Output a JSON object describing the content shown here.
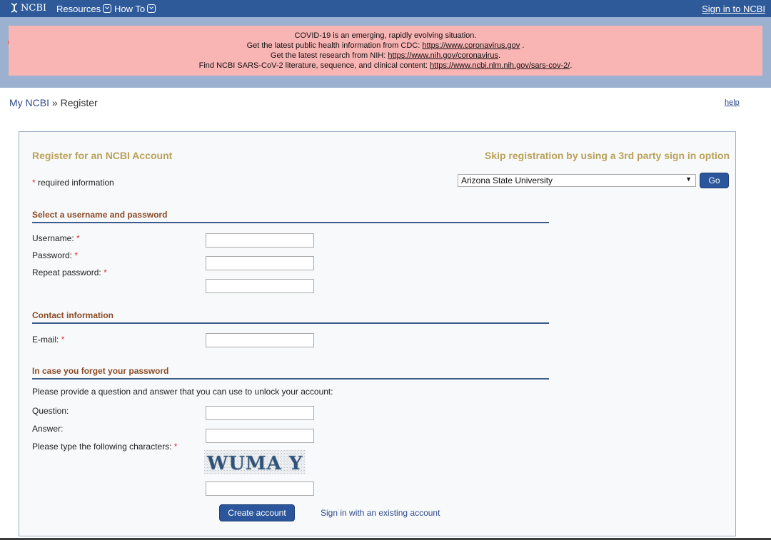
{
  "topbar": {
    "logo_text": "NCBI",
    "menu_resources": "Resources",
    "menu_howto": "How To",
    "signin": "Sign in to NCBI"
  },
  "banner": {
    "line1": "COVID-19 is an emerging, rapidly evolving situation.",
    "line2_prefix": "Get the latest public health information from CDC: ",
    "line2_link": "https://www.coronavirus.gov",
    "line2_suffix": " .",
    "line3_prefix": "Get the latest research from NIH: ",
    "line3_link": "https://www.nih.gov/coronavirus",
    "line3_suffix": ".",
    "line4_prefix": "Find NCBI SARS-CoV-2 literature, sequence, and clinical content: ",
    "line4_link": "https://www.ncbi.nlm.nih.gov/sars-cov-2/",
    "line4_suffix": "."
  },
  "breadcrumb": {
    "root": "My NCBI",
    "sep": " » ",
    "current": "Register"
  },
  "help": "help",
  "form": {
    "title": "Register for an NCBI Account",
    "skip_title": "Skip registration by using a 3rd party sign in option",
    "required_note": " required information",
    "asterisk": "*",
    "provider_selected": "Arizona State University",
    "go_label": "Go",
    "section_credentials": "Select a username and password",
    "username_label": "Username:",
    "password_label": "Password:",
    "repeat_password_label": "Repeat password:",
    "section_contact": "Contact information",
    "email_label": "E-mail:",
    "section_recovery": "In case you forget your password",
    "recovery_instructions": "Please provide a question and answer that you can use to unlock your account:",
    "question_label": "Question:",
    "answer_label": "Answer:",
    "captcha_label": "Please type the following characters:",
    "captcha_text": "WUMA Y",
    "create_label": "Create account",
    "existing_link": "Sign in with an existing account"
  },
  "colors": {
    "topbar": "#2e5a9a",
    "banner": "#f9b4b4",
    "heading_gold": "#b9a159",
    "section_brown": "#8a4a25",
    "button_blue": "#2b569b"
  }
}
